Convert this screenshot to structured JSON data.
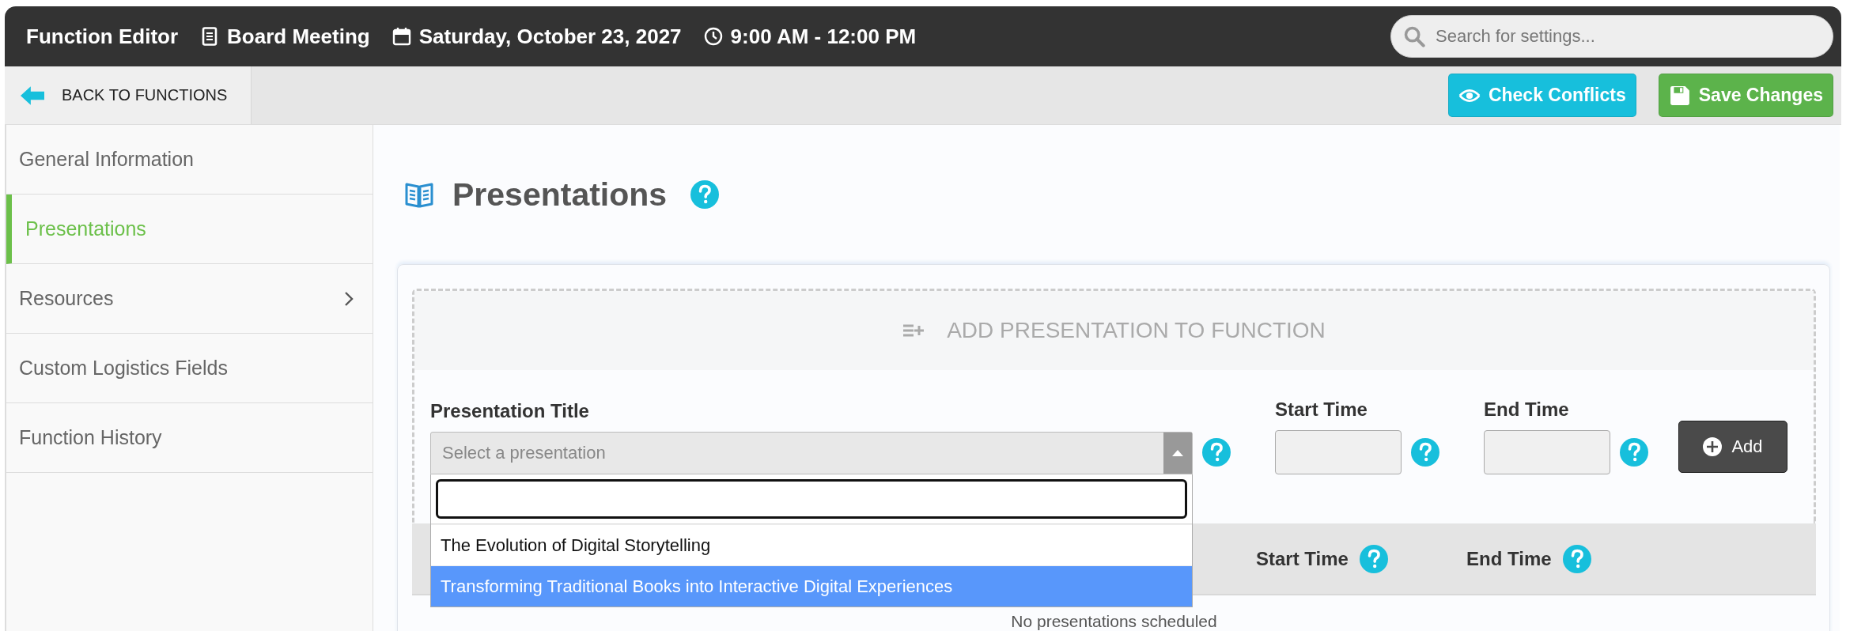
{
  "header": {
    "title": "Function Editor",
    "event": "Board Meeting",
    "date": "Saturday, October 23, 2027",
    "time": "9:00 AM - 12:00 PM",
    "search": {
      "placeholder": "Search for settings..."
    }
  },
  "toolbar": {
    "back": "BACK TO FUNCTIONS",
    "buttons": [
      {
        "label": "Check Conflicts",
        "kind": "check"
      },
      {
        "label": "Save Changes",
        "kind": "save"
      }
    ]
  },
  "sidebar": {
    "items": [
      {
        "label": "General Information",
        "selected": false,
        "has_submenu": false
      },
      {
        "label": "Presentations",
        "selected": true,
        "has_submenu": false
      },
      {
        "label": "Resources",
        "selected": false,
        "has_submenu": true
      },
      {
        "label": "Custom Logistics Fields",
        "selected": false,
        "has_submenu": false
      },
      {
        "label": "Function History",
        "selected": false,
        "has_submenu": false
      }
    ]
  },
  "section": {
    "title": "Presentations"
  },
  "add_panel": {
    "heading": "ADD PRESENTATION TO FUNCTION",
    "fields": [
      {
        "label": "Presentation Title",
        "kind": "select",
        "placeholder": "Select a presentation"
      },
      {
        "label": "Start Time",
        "kind": "text"
      },
      {
        "label": "End Time",
        "kind": "text"
      }
    ],
    "add_button": "Add"
  },
  "dropdown": {
    "expanded": true,
    "options": [
      {
        "label": "The Evolution of Digital Storytelling",
        "selected": false
      },
      {
        "label": "Transforming Traditional Books into Interactive Digital Experiences",
        "selected": true
      }
    ]
  },
  "table": {
    "columns": [
      "Start Time",
      "End Time"
    ],
    "empty_message": "No presentations scheduled"
  }
}
